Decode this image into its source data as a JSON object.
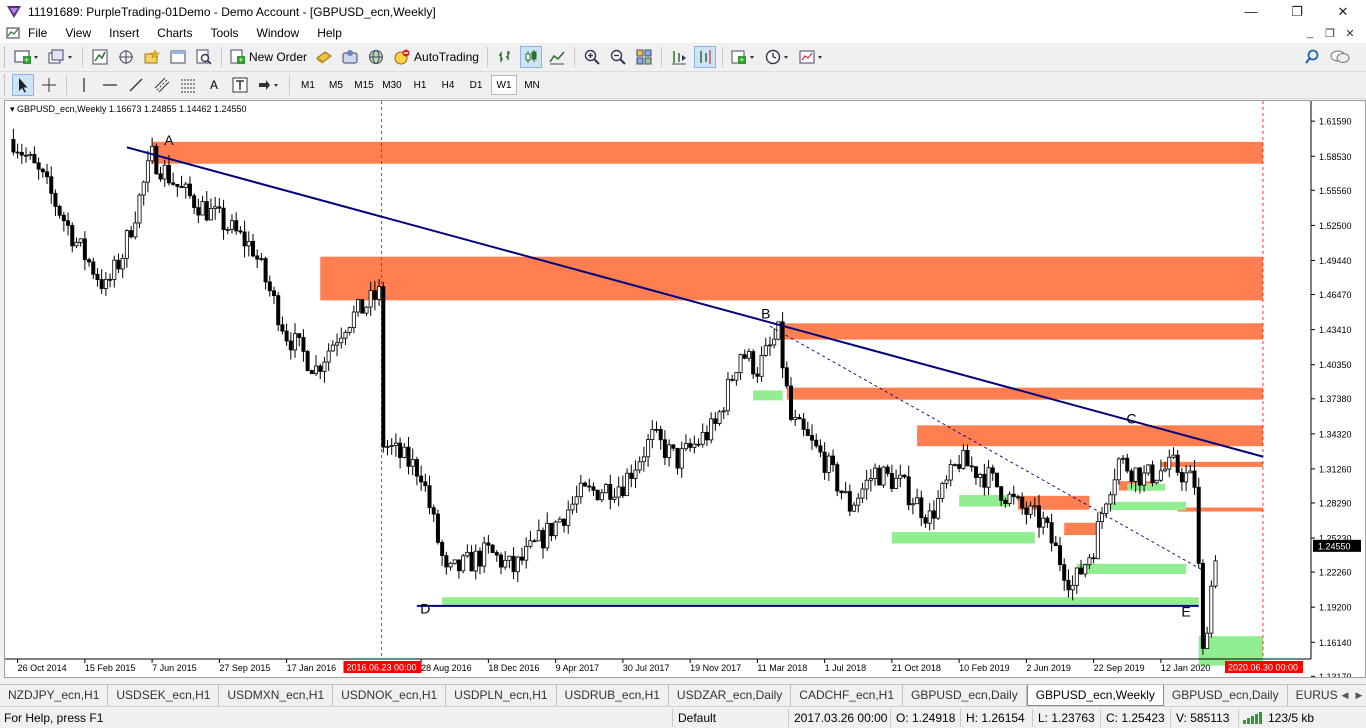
{
  "window": {
    "title": "11191689: PurpleTrading-01Demo - Demo Account - [GBPUSD_ecn,Weekly]",
    "minimize_glyph": "—",
    "maximize_glyph": "❐",
    "close_glyph": "✕"
  },
  "menu": {
    "items": [
      "File",
      "View",
      "Insert",
      "Charts",
      "Tools",
      "Window",
      "Help"
    ],
    "mdi_minimize": "_",
    "mdi_restore": "❐",
    "mdi_close": "✕"
  },
  "toolbar": {
    "new_order_label": "New Order",
    "autotrading_label": "AutoTrading",
    "text_tool_label": "A",
    "timeframes": [
      "M1",
      "M5",
      "M15",
      "M30",
      "H1",
      "H4",
      "D1",
      "W1",
      "MN"
    ],
    "active_timeframe": "W1"
  },
  "chart": {
    "info_text": "GBPUSD_ecn,Weekly  1.16673 1.24855 1.14462 1.24550",
    "current_price_label": "1.24550",
    "colors": {
      "bull": "#ffffff",
      "bear": "#000000",
      "resistance": "#ff7f50",
      "support": "#90ee90",
      "trendline": "#000080",
      "vline": "#ff0000"
    },
    "point_labels": [
      "A",
      "B",
      "C",
      "D",
      "E"
    ],
    "vline_labels": [
      "2016.06.23 00:00",
      "2020.06.30 00:00"
    ]
  },
  "chart_data": {
    "type": "candlestick",
    "ylim": [
      1.1468,
      1.6335
    ],
    "yticks": [
      "1.61590",
      "1.58530",
      "1.55560",
      "1.52500",
      "1.49440",
      "1.46470",
      "1.43410",
      "1.40350",
      "1.37380",
      "1.34320",
      "1.31260",
      "1.28290",
      "1.25230",
      "1.22260",
      "1.19200",
      "1.16140",
      "1.13170"
    ],
    "xticks": [
      "26 Oct 2014",
      "15 Feb 2015",
      "7 Jun 2015",
      "27 Sep 2015",
      "17 Jan 2016",
      "28 Aug 2016",
      "18 Dec 2016",
      "9 Apr 2017",
      "30 Jul 2017",
      "19 Nov 2017",
      "11 Mar 2018",
      "1 Jul 2018",
      "21 Oct 2018",
      "10 Feb 2019",
      "2 Jun 2019",
      "22 Sep 2019",
      "12 Jan 2020"
    ],
    "path_points": [
      [
        "2014-10-19",
        1.6
      ],
      [
        "2014-12-07",
        1.565
      ],
      [
        "2015-02-01",
        1.51
      ],
      [
        "2015-03-22",
        1.47
      ],
      [
        "2015-04-19",
        1.5
      ],
      [
        "2015-06-07",
        1.585
      ],
      [
        "2015-07-26",
        1.555
      ],
      [
        "2015-09-27",
        1.53
      ],
      [
        "2015-11-22",
        1.505
      ],
      [
        "2016-01-17",
        1.43
      ],
      [
        "2016-03-06",
        1.4
      ],
      [
        "2016-04-24",
        1.44
      ],
      [
        "2016-06-19",
        1.465
      ],
      [
        "2016-06-26",
        1.335
      ],
      [
        "2016-08-28",
        1.31
      ],
      [
        "2016-10-09",
        1.22
      ],
      [
        "2016-12-18",
        1.24
      ],
      [
        "2017-01-29",
        1.225
      ],
      [
        "2017-04-09",
        1.265
      ],
      [
        "2017-05-21",
        1.29
      ],
      [
        "2017-07-30",
        1.3
      ],
      [
        "2017-09-17",
        1.34
      ],
      [
        "2017-10-29",
        1.32
      ],
      [
        "2017-12-31",
        1.35
      ],
      [
        "2018-02-11",
        1.415
      ],
      [
        "2018-03-11",
        1.4
      ],
      [
        "2018-04-15",
        1.43
      ],
      [
        "2018-05-06",
        1.355
      ],
      [
        "2018-07-01",
        1.32
      ],
      [
        "2018-08-12",
        1.28
      ],
      [
        "2018-09-23",
        1.31
      ],
      [
        "2018-11-04",
        1.3
      ],
      [
        "2018-12-23",
        1.27
      ],
      [
        "2019-02-10",
        1.32
      ],
      [
        "2019-03-31",
        1.305
      ],
      [
        "2019-05-19",
        1.28
      ],
      [
        "2019-06-30",
        1.265
      ],
      [
        "2019-08-18",
        1.21
      ],
      [
        "2019-09-22",
        1.245
      ],
      [
        "2019-10-13",
        1.29
      ],
      [
        "2019-11-03",
        1.32
      ],
      [
        "2019-12-15",
        1.305
      ],
      [
        "2020-02-02",
        1.315
      ],
      [
        "2020-03-08",
        1.3
      ],
      [
        "2020-03-22",
        1.15
      ],
      [
        "2020-04-12",
        1.24
      ]
    ],
    "zones": [
      {
        "kind": "resistance",
        "x1": "2015-06-07",
        "x2": "2020-06-30",
        "ymin": 1.5788,
        "ymax": 1.5979
      },
      {
        "kind": "resistance",
        "x1": "2016-03-13",
        "x2": "2020-06-30",
        "ymin": 1.4596,
        "ymax": 1.4977
      },
      {
        "kind": "resistance",
        "x1": "2018-04-15",
        "x2": "2020-06-30",
        "ymin": 1.4254,
        "ymax": 1.4396
      },
      {
        "kind": "resistance",
        "x1": "2018-04-29",
        "x2": "2020-06-30",
        "ymin": 1.373,
        "ymax": 1.3835
      },
      {
        "kind": "resistance",
        "x1": "2018-12-02",
        "x2": "2020-06-30",
        "ymin": 1.3324,
        "ymax": 1.3506
      },
      {
        "kind": "resistance",
        "x1": "2020-01-12",
        "x2": "2020-06-30",
        "ymin": 1.3143,
        "ymax": 1.3188
      },
      {
        "kind": "resistance",
        "x1": "2019-05-19",
        "x2": "2019-09-15",
        "ymin": 1.277,
        "ymax": 1.2891
      },
      {
        "kind": "resistance",
        "x1": "2019-08-04",
        "x2": "2019-09-29",
        "ymin": 1.2549,
        "ymax": 1.2656
      },
      {
        "kind": "resistance",
        "x1": "2019-11-03",
        "x2": "2019-12-29",
        "ymin": 1.2937,
        "ymax": 1.3019
      },
      {
        "kind": "resistance",
        "x1": "2020-02-09",
        "x2": "2020-06-30",
        "ymin": 1.2754,
        "ymax": 1.2789
      },
      {
        "kind": "support",
        "x1": "2018-03-04",
        "x2": "2018-04-22",
        "ymin": 1.3724,
        "ymax": 1.381
      },
      {
        "kind": "support",
        "x1": "2019-02-10",
        "x2": "2019-05-05",
        "ymin": 1.2798,
        "ymax": 1.2898
      },
      {
        "kind": "support",
        "x1": "2018-10-21",
        "x2": "2019-06-16",
        "ymin": 1.2475,
        "ymax": 1.2575
      },
      {
        "kind": "support",
        "x1": "2019-10-20",
        "x2": "2020-02-23",
        "ymin": 1.2767,
        "ymax": 1.2839
      },
      {
        "kind": "support",
        "x1": "2019-11-17",
        "x2": "2020-01-19",
        "ymin": 1.2936,
        "ymax": 1.2997
      },
      {
        "kind": "support",
        "x1": "2019-08-25",
        "x2": "2020-02-23",
        "ymin": 1.2209,
        "ymax": 1.2298
      },
      {
        "kind": "support",
        "x1": "2016-10-02",
        "x2": "2020-03-15",
        "ymin": 1.1941,
        "ymax": 1.2007
      },
      {
        "kind": "support",
        "x1": "2020-03-15",
        "x2": "2020-06-30",
        "ymin": 1.141,
        "ymax": 1.1667
      }
    ],
    "lines": [
      {
        "style": "solid",
        "from": [
          "2015-04-26",
          1.5931
        ],
        "to": [
          "2020-06-30",
          1.3233
        ]
      },
      {
        "style": "dashed",
        "from": [
          "2018-04-01",
          1.4371
        ],
        "to": [
          "2020-03-22",
          1.2242
        ]
      },
      {
        "style": "solid",
        "from": [
          "2016-08-21",
          1.1931
        ],
        "to": [
          "2020-03-15",
          1.1931
        ]
      }
    ],
    "labeled_points": [
      {
        "label": "A",
        "x": "2015-07-05",
        "y": 1.595
      },
      {
        "label": "B",
        "x": "2018-03-25",
        "y": 1.444
      },
      {
        "label": "C",
        "x": "2019-11-24",
        "y": 1.352
      },
      {
        "label": "D",
        "x": "2016-09-04",
        "y": 1.1865
      },
      {
        "label": "E",
        "x": "2020-02-23",
        "y": 1.184
      }
    ],
    "vlines": [
      {
        "x": "2016-06-23",
        "label": "2016.06.23 00:00"
      },
      {
        "x": "2020-06-30",
        "label": "2020.06.30 00:00"
      }
    ]
  },
  "tabs": {
    "items": [
      "NZDJPY_ecn,H1",
      "USDSEK_ecn,H1",
      "USDMXN_ecn,H1",
      "USDNOK_ecn,H1",
      "USDPLN_ecn,H1",
      "USDRUB_ecn,H1",
      "USDZAR_ecn,Daily",
      "CADCHF_ecn,H1",
      "GBPUSD_ecn,Daily",
      "GBPUSD_ecn,Weekly",
      "GBPUSD_ecn,Daily",
      "EURUSD_e"
    ],
    "active_index": 9,
    "left_arrow": "◀",
    "right_arrow": "▶"
  },
  "status": {
    "help": "For Help, press F1",
    "profile": "Default",
    "datetime": "2017.03.26 00:00",
    "open": "O: 1.24918",
    "high": "H: 1.26154",
    "low": "L: 1.23763",
    "close": "C: 1.25423",
    "volume": "V: 585113",
    "traffic": "123/5 kb"
  }
}
